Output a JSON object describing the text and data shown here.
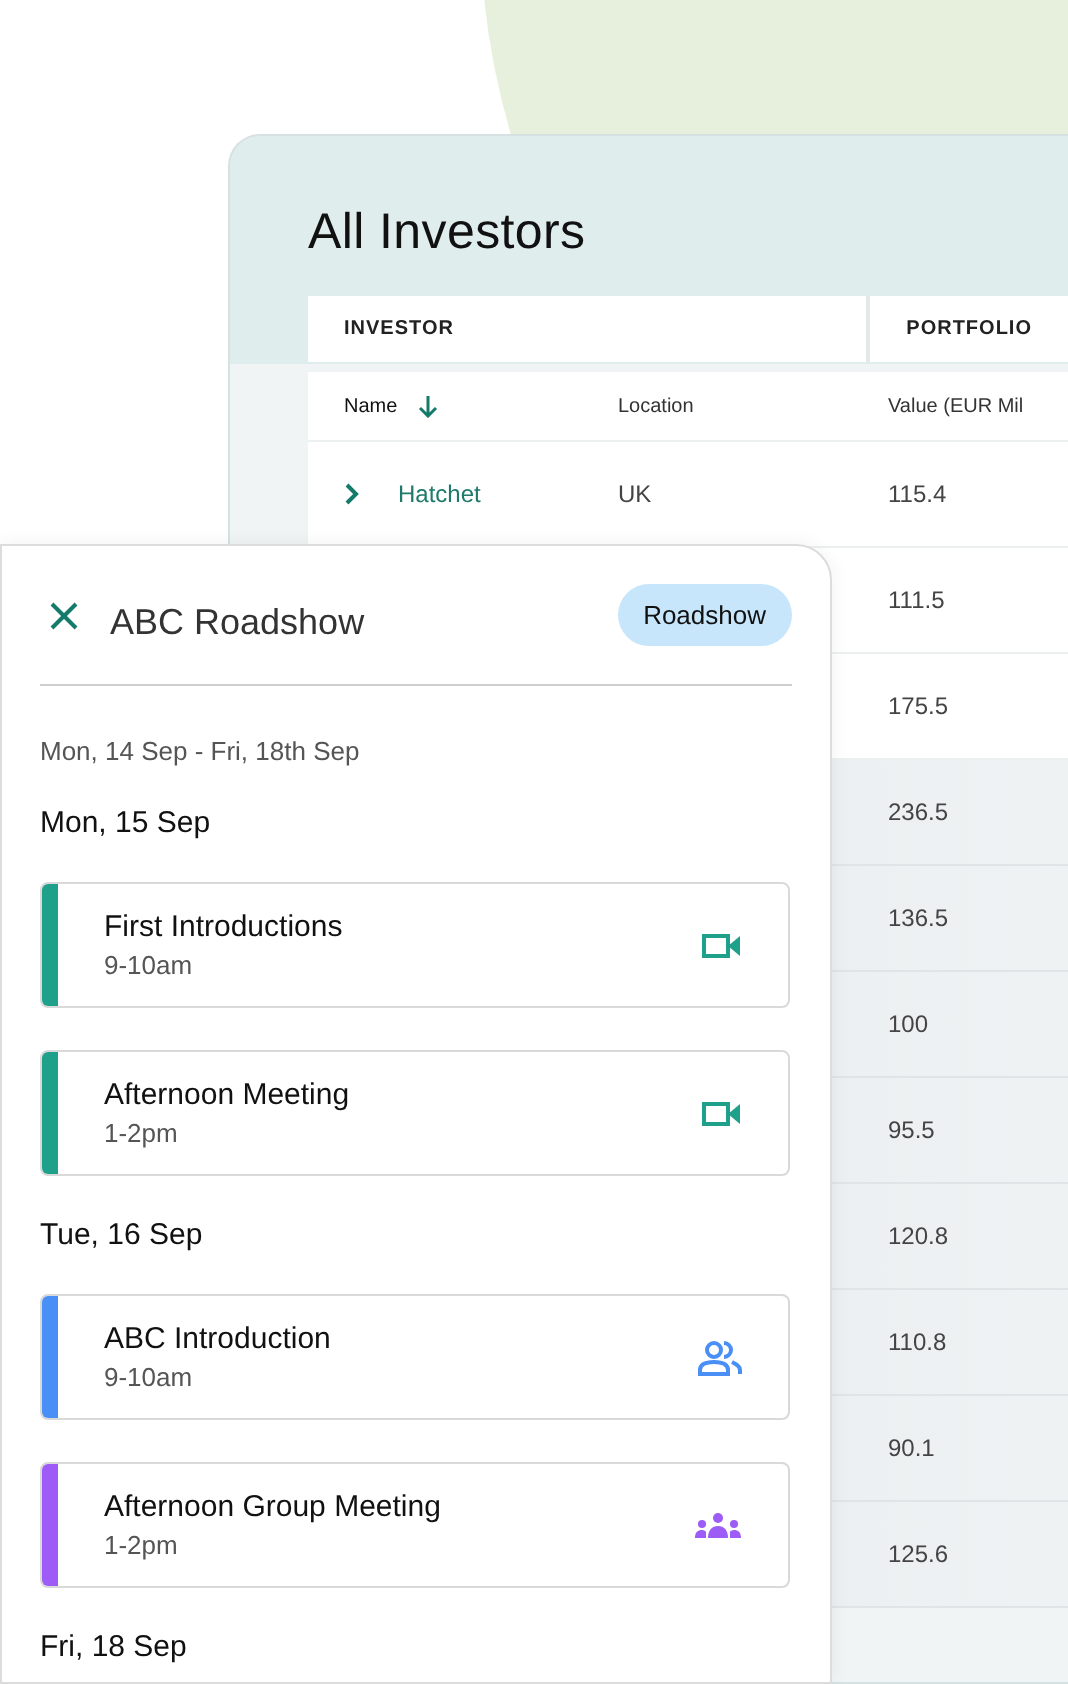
{
  "investors": {
    "title": "All Investors",
    "column_groups": [
      "INVESTOR",
      "PORTFOLIO"
    ],
    "columns": [
      {
        "label": "Name",
        "sorted": true
      },
      {
        "label": "Location",
        "sorted": false
      },
      {
        "label": "Value (EUR Mil",
        "sorted": false
      }
    ],
    "rows": [
      {
        "name": "Hatchet",
        "location": "UK",
        "value": "115.4",
        "expanded": false
      },
      {
        "value": "111.5"
      },
      {
        "value": "175.5"
      },
      {
        "value": "236.5"
      },
      {
        "value": "136.5"
      },
      {
        "value": "100"
      },
      {
        "value": "95.5"
      },
      {
        "value": "120.8"
      },
      {
        "value": "110.8"
      },
      {
        "value": "90.1"
      },
      {
        "value": "125.6"
      }
    ]
  },
  "roadshow": {
    "title": "ABC Roadshow",
    "tag": "Roadshow",
    "date_range": "Mon, 14 Sep - Fri, 18th Sep",
    "days": [
      {
        "label": "Mon, 15 Sep",
        "events": [
          {
            "title": "First Introductions",
            "time": "9-10am",
            "kind": "video",
            "color": "#1fa08a"
          },
          {
            "title": "Afternoon Meeting",
            "time": "1-2pm",
            "kind": "video",
            "color": "#1fa08a"
          }
        ]
      },
      {
        "label": "Tue, 16 Sep",
        "events": [
          {
            "title": "ABC Introduction",
            "time": "9-10am",
            "kind": "people",
            "color": "#4a8ff5"
          },
          {
            "title": "Afternoon Group Meeting",
            "time": "1-2pm",
            "kind": "group",
            "color": "#9d5cf5"
          }
        ]
      },
      {
        "label": "Fri, 18 Sep"
      }
    ]
  }
}
